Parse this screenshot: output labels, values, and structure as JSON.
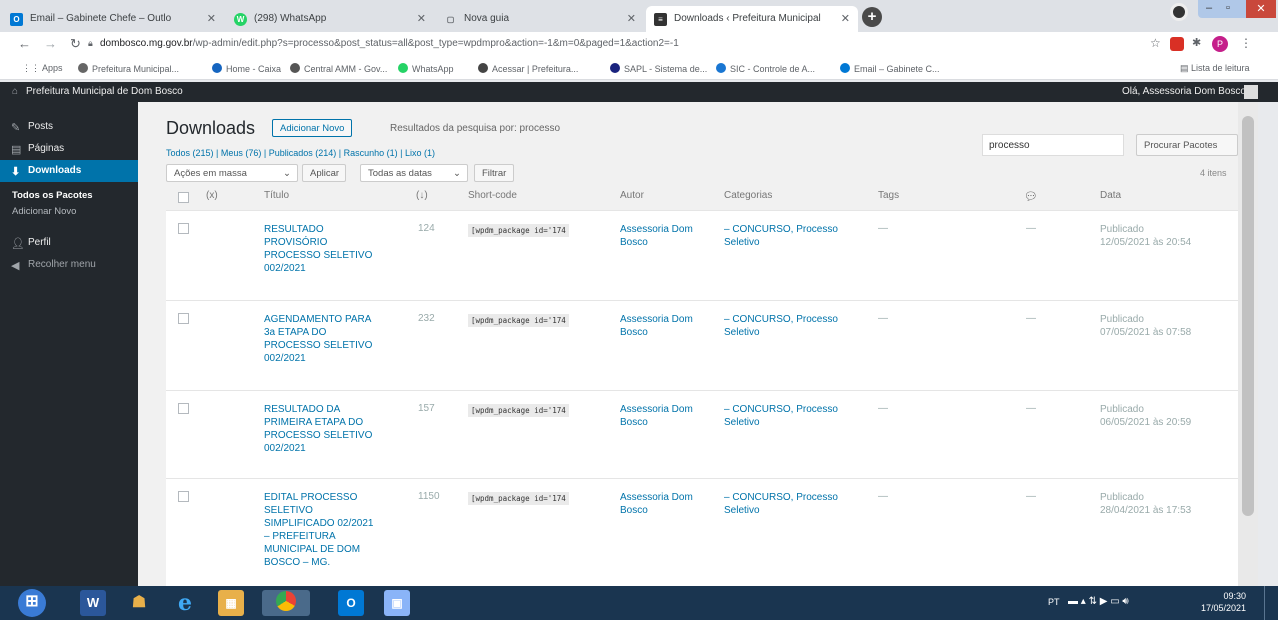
{
  "tabs": [
    {
      "label": "Email – Gabinete Chefe – Outlo",
      "color": "#0078d4",
      "glyph": "O"
    },
    {
      "label": "(298) WhatsApp",
      "color": "#25d366",
      "glyph": "W"
    },
    {
      "label": "Nova guia",
      "color": "#9aa0a6",
      "glyph": ""
    },
    {
      "label": "Downloads ‹ Prefeitura Municipal",
      "color": "#333333",
      "glyph": "≡"
    }
  ],
  "address": {
    "domain": "dombosco.mg.gov.br",
    "path": "/wp-admin/edit.php?s=processo&post_status=all&post_type=wpdmpro&action=-1&m=0&paged=1&action2=-1"
  },
  "bookmarks": [
    "Apps",
    "Prefeitura Municipal...",
    "Home - Caixa",
    "Central AMM - Gov...",
    "WhatsApp",
    "Acessar | Prefeitura...",
    "SAPL - Sistema de...",
    "SIC - Controle de A...",
    "Email – Gabinete C...",
    "Lista de leitura"
  ],
  "adminbar": {
    "site": "Prefeitura Municipal de Dom Bosco",
    "greeting": "Olá, Assessoria Dom Bosco"
  },
  "sidebar": {
    "items": [
      {
        "label": "Posts",
        "icon": "pin-icon"
      },
      {
        "label": "Páginas",
        "icon": "pages-icon"
      },
      {
        "label": "Downloads",
        "icon": "download-icon"
      }
    ],
    "sub": [
      "Todos os Pacotes",
      "Adicionar Novo"
    ],
    "items2": [
      {
        "label": "Perfil",
        "icon": "user-icon"
      },
      {
        "label": "Recolher menu",
        "icon": "collapse-icon"
      }
    ]
  },
  "page": {
    "title": "Downloads",
    "add_new": "Adicionar Novo",
    "search_note": "Resultados da pesquisa por: processo",
    "filters": "Todos (215) | Meus (76) | Publicados (214) | Rascunho (1) | Lixo (1)",
    "bulk_select": "Ações em massa",
    "apply": "Aplicar",
    "dates_select": "Todas as datas",
    "filter": "Filtrar",
    "search_value": "processo",
    "search_button": "Procurar Pacotes",
    "count": "4 itens"
  },
  "table": {
    "headers": {
      "id": "(x)",
      "title": "Título",
      "dl": "(↓)",
      "shortcode": "Short-code",
      "author": "Autor",
      "categories": "Categorias",
      "tags": "Tags",
      "date": "Data"
    },
    "rows": [
      {
        "title": "RESULTADO\nPROVISÓRIO\nPROCESSO SELETIVO\n002/2021",
        "downloads": "124",
        "shortcode": "[wpdm_package id='174",
        "author": "Assessoria Dom\nBosco",
        "categories": "– CONCURSO, Processo\nSeletivo",
        "tags": "—",
        "comments": "—",
        "date": "Publicado\n12/05/2021 às 20:54"
      },
      {
        "title": "AGENDAMENTO PARA\n3a ETAPA DO\nPROCESSO SELETIVO\n002/2021",
        "downloads": "232",
        "shortcode": "[wpdm_package id='174",
        "author": "Assessoria Dom\nBosco",
        "categories": "– CONCURSO, Processo\nSeletivo",
        "tags": "—",
        "comments": "—",
        "date": "Publicado\n07/05/2021 às 07:58"
      },
      {
        "title": "RESULTADO DA\nPRIMEIRA ETAPA DO\nPROCESSO SELETIVO\n002/2021",
        "downloads": "157",
        "shortcode": "[wpdm_package id='174",
        "author": "Assessoria Dom\nBosco",
        "categories": "– CONCURSO, Processo\nSeletivo",
        "tags": "—",
        "comments": "—",
        "date": "Publicado\n06/05/2021 às 20:59"
      },
      {
        "title": "EDITAL PROCESSO\nSELETIVO\nSIMPLIFICADO 02/2021\n– PREFEITURA\nMUNICIPAL DE DOM\nBOSCO – MG.",
        "downloads": "1150",
        "shortcode": "[wpdm_package id='174",
        "author": "Assessoria Dom\nBosco",
        "categories": "– CONCURSO, Processo\nSeletivo",
        "tags": "—",
        "comments": "—",
        "date": "Publicado\n28/04/2021 às 17:53"
      }
    ]
  },
  "taskbar": {
    "time": "09:30",
    "date": "17/05/2021",
    "tray": "PT"
  }
}
